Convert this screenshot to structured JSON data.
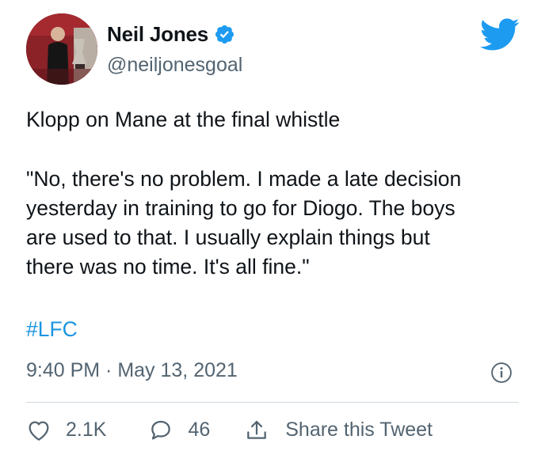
{
  "tweet": {
    "author_name": "Neil Jones",
    "author_handle": "@neiljonesgoal",
    "verified": true,
    "text_line1": "Klopp on Mane at the final whistle",
    "quote_lines": [
      "\"No, there's no problem. I made a late decision",
      "yesterday in training to go for Diogo. The boys",
      "are used to that. I usually explain things but",
      "there was no time. It's all fine.\""
    ],
    "hashtag": "#LFC",
    "timestamp": "9:40 PM · May 13, 2021"
  },
  "actions": {
    "likes": "2.1K",
    "replies": "46",
    "share_label": "Share this Tweet"
  },
  "colors": {
    "twitter_blue": "#1d9bf0",
    "link_blue": "#1b95e0",
    "text_primary": "#0f1419",
    "text_secondary": "#536471",
    "divider": "#cfd9de"
  },
  "icons": {
    "verified": "verified-badge-icon",
    "logo": "twitter-bird-icon",
    "info": "info-icon",
    "like": "heart-icon",
    "reply": "reply-bubble-icon",
    "share": "share-icon"
  }
}
